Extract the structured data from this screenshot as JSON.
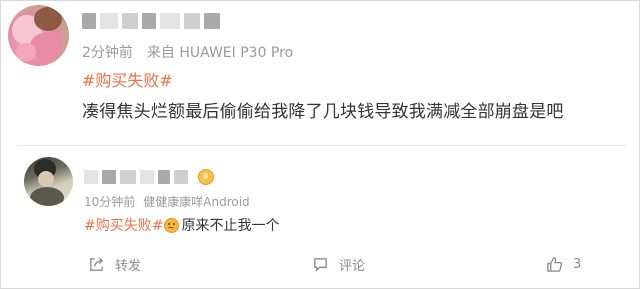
{
  "comments": [
    {
      "time": "2分钟前",
      "source": "来自 HUAWEI P30 Pro",
      "hashtag": "#购买失败#",
      "text": "凑得焦头烂额最后偷偷给我降了几块钱导致我满减全部崩盘是吧"
    },
    {
      "time": "10分钟前",
      "source": "健健康康咩Android",
      "hashtag": "#购买失败#",
      "text": "原来不止我一个"
    }
  ],
  "actions": {
    "share_label": "转发",
    "comment_label": "评论",
    "like_count": "3"
  },
  "colors": {
    "hashtag": "#eb7350",
    "meta": "#9b9b9b",
    "body_text": "#333333"
  },
  "icons": [
    "share-icon",
    "comment-icon",
    "like-icon",
    "emoji-icon",
    "badge-icon"
  ]
}
